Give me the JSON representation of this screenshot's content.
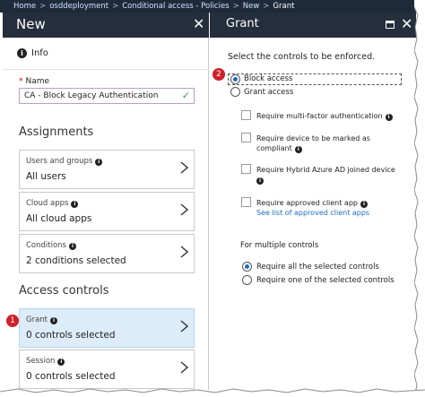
{
  "breadcrumb": [
    "Home",
    "osddeployment",
    "Conditional access - Policies",
    "New",
    "Grant"
  ],
  "new_blade": {
    "title": "New",
    "info_label": "Info",
    "name_label": "Name",
    "name_value": "CA - Block Legacy Authentication",
    "assignments_heading": "Assignments",
    "cards": [
      {
        "key": "Users and groups",
        "value": "All users",
        "info": true
      },
      {
        "key": "Cloud apps",
        "value": "All cloud apps",
        "info": true
      },
      {
        "key": "Conditions",
        "value": "2 conditions selected",
        "info": true
      }
    ],
    "access_heading": "Access controls",
    "access_cards": [
      {
        "key": "Grant",
        "value": "0 controls selected",
        "info": true,
        "selected": true
      },
      {
        "key": "Session",
        "value": "0 controls selected",
        "info": true,
        "selected": false
      }
    ],
    "callout_1": "1"
  },
  "grant_blade": {
    "title": "Grant",
    "instruction": "Select the controls to be enforced.",
    "callout_2": "2",
    "radio_block": "Block access",
    "radio_grant": "Grant access",
    "radio_selected": "Block access",
    "checkboxes": [
      {
        "line1": "Require multi-factor authentication",
        "line2": "",
        "checked": false
      },
      {
        "line1": "Require device to be marked as",
        "line2": "compliant",
        "checked": false
      },
      {
        "line1": "Require Hybrid Azure AD joined device",
        "line2": "",
        "checked": false
      },
      {
        "line1": "Require approved client app",
        "line2": "See list of approved client apps",
        "checked": false
      }
    ],
    "multiple_heading": "For multiple controls",
    "multi_require_all": "Require all the selected controls",
    "multi_require_one": "Require one of the selected controls",
    "multi_selected": "Require all the selected controls"
  },
  "colors": {
    "header_bg": "#252e3c",
    "accent": "#1d6bc4",
    "callout": "#d0212a",
    "selected_card": "#dcecf8"
  }
}
